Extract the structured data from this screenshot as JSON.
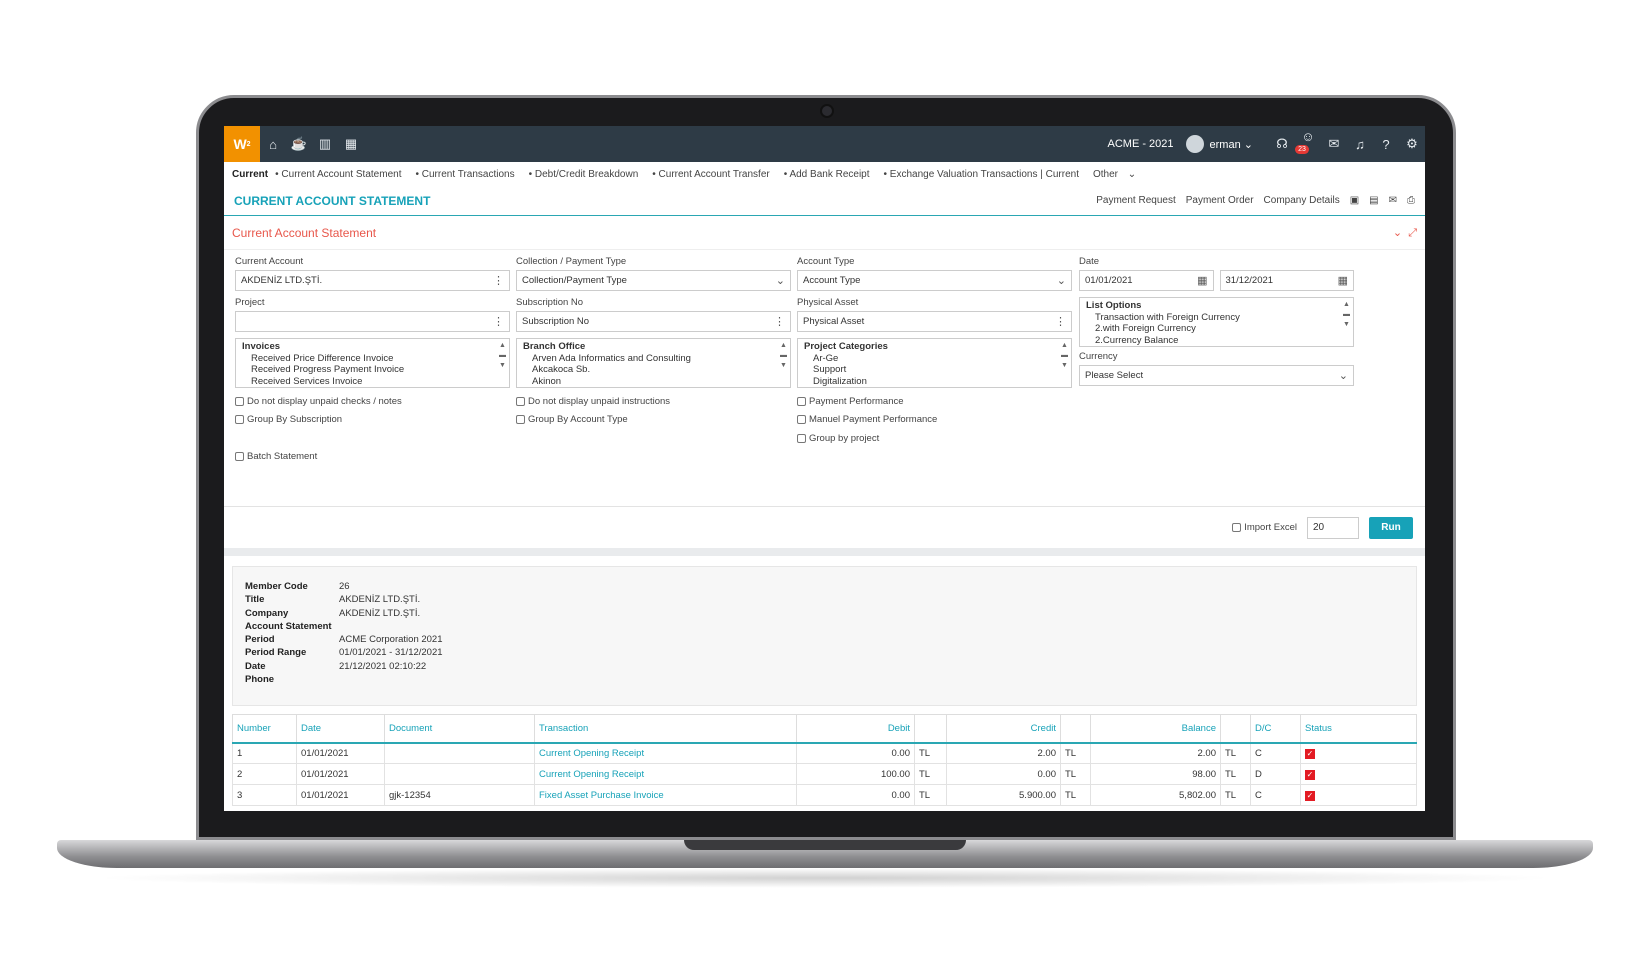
{
  "topbar": {
    "logo": "W",
    "logo_sup": "2",
    "company": "ACME - 2021",
    "user": "erman",
    "notif_count": "23"
  },
  "breadcrumbs": [
    "Current",
    "Current Account Statement",
    "Current Transactions",
    "Debt/Credit Breakdown",
    "Current Account Transfer",
    "Add Bank Receipt",
    "Exchange Valuation Transactions | Current",
    "Other"
  ],
  "page": {
    "title": "CURRENT ACCOUNT STATEMENT",
    "links": [
      "Payment Request",
      "Payment Order",
      "Company Details"
    ]
  },
  "panel": {
    "title": "Current Account Statement"
  },
  "form": {
    "current_account": {
      "label": "Current Account",
      "value": "AKDENİZ LTD.ŞTİ."
    },
    "project": {
      "label": "Project",
      "value": ""
    },
    "invoices": {
      "header": "Invoices",
      "items": [
        "Received Price Difference Invoice",
        "Received Progress Payment Invoice",
        "Received Services Invoice"
      ]
    },
    "collection_type": {
      "label": "Collection / Payment Type",
      "placeholder": "Collection/Payment Type"
    },
    "subscription_no": {
      "label": "Subscription No",
      "placeholder": "Subscription No"
    },
    "branch_office": {
      "header": "Branch Office",
      "items": [
        "Arven Ada Informatics and Consulting",
        "Akcakoca Sb.",
        "Akinon"
      ]
    },
    "account_type": {
      "label": "Account Type",
      "placeholder": "Account Type"
    },
    "physical_asset": {
      "label": "Physical Asset",
      "placeholder": "Physical Asset"
    },
    "project_categories": {
      "header": "Project Categories",
      "items": [
        "Ar-Ge",
        "Support",
        "Digitalization"
      ]
    },
    "date": {
      "label": "Date",
      "from": "01/01/2021",
      "to": "31/12/2021"
    },
    "list_options": {
      "header": "List Options",
      "items": [
        "Transaction with Foreign Currency",
        "2.with Foreign Currency",
        "2.Currency Balance"
      ]
    },
    "currency": {
      "label": "Currency",
      "value": "Please Select"
    },
    "checks": {
      "unpaid_checks": "Do not display unpaid checks / notes",
      "group_subscription": "Group By Subscription",
      "batch_statement": "Batch Statement",
      "unpaid_instructions": "Do not display unpaid instructions",
      "group_account_type": "Group By Account Type",
      "payment_performance": "Payment Performance",
      "manual_payment_performance": "Manuel Payment Performance",
      "group_project": "Group by project"
    }
  },
  "run": {
    "import_excel": "Import Excel",
    "page_size": "20",
    "button": "Run"
  },
  "report": {
    "info": [
      {
        "k": "Member Code",
        "v": "26"
      },
      {
        "k": "Title",
        "v": "AKDENİZ LTD.ŞTİ."
      },
      {
        "k": "Company",
        "v": "AKDENİZ LTD.ŞTİ."
      },
      {
        "k": "Account Statement",
        "v": ""
      },
      {
        "k": "Period",
        "v": "ACME Corporation 2021"
      },
      {
        "k": "Period Range",
        "v": "01/01/2021 - 31/12/2021"
      },
      {
        "k": "Date",
        "v": "21/12/2021 02:10:22"
      },
      {
        "k": "Phone",
        "v": ""
      }
    ],
    "columns": [
      "Number",
      "Date",
      "Document",
      "Transaction",
      "Debit",
      "",
      "Credit",
      "",
      "Balance",
      "",
      "D/C",
      "Status"
    ],
    "rows": [
      {
        "number": "1",
        "date": "01/01/2021",
        "document": "",
        "transaction": "Current Opening Receipt",
        "debit": "0.00",
        "debit_cur": "TL",
        "credit": "2.00",
        "credit_cur": "TL",
        "balance": "2.00",
        "balance_cur": "TL",
        "dc": "C"
      },
      {
        "number": "2",
        "date": "01/01/2021",
        "document": "",
        "transaction": "Current Opening Receipt",
        "debit": "100.00",
        "debit_cur": "TL",
        "credit": "0.00",
        "credit_cur": "TL",
        "balance": "98.00",
        "balance_cur": "TL",
        "dc": "D"
      },
      {
        "number": "3",
        "date": "01/01/2021",
        "document": "gjk-12354",
        "transaction": "Fixed Asset Purchase Invoice",
        "debit": "0.00",
        "debit_cur": "TL",
        "credit": "5.900.00",
        "credit_cur": "TL",
        "balance": "5,802.00",
        "balance_cur": "TL",
        "dc": "C"
      }
    ]
  }
}
